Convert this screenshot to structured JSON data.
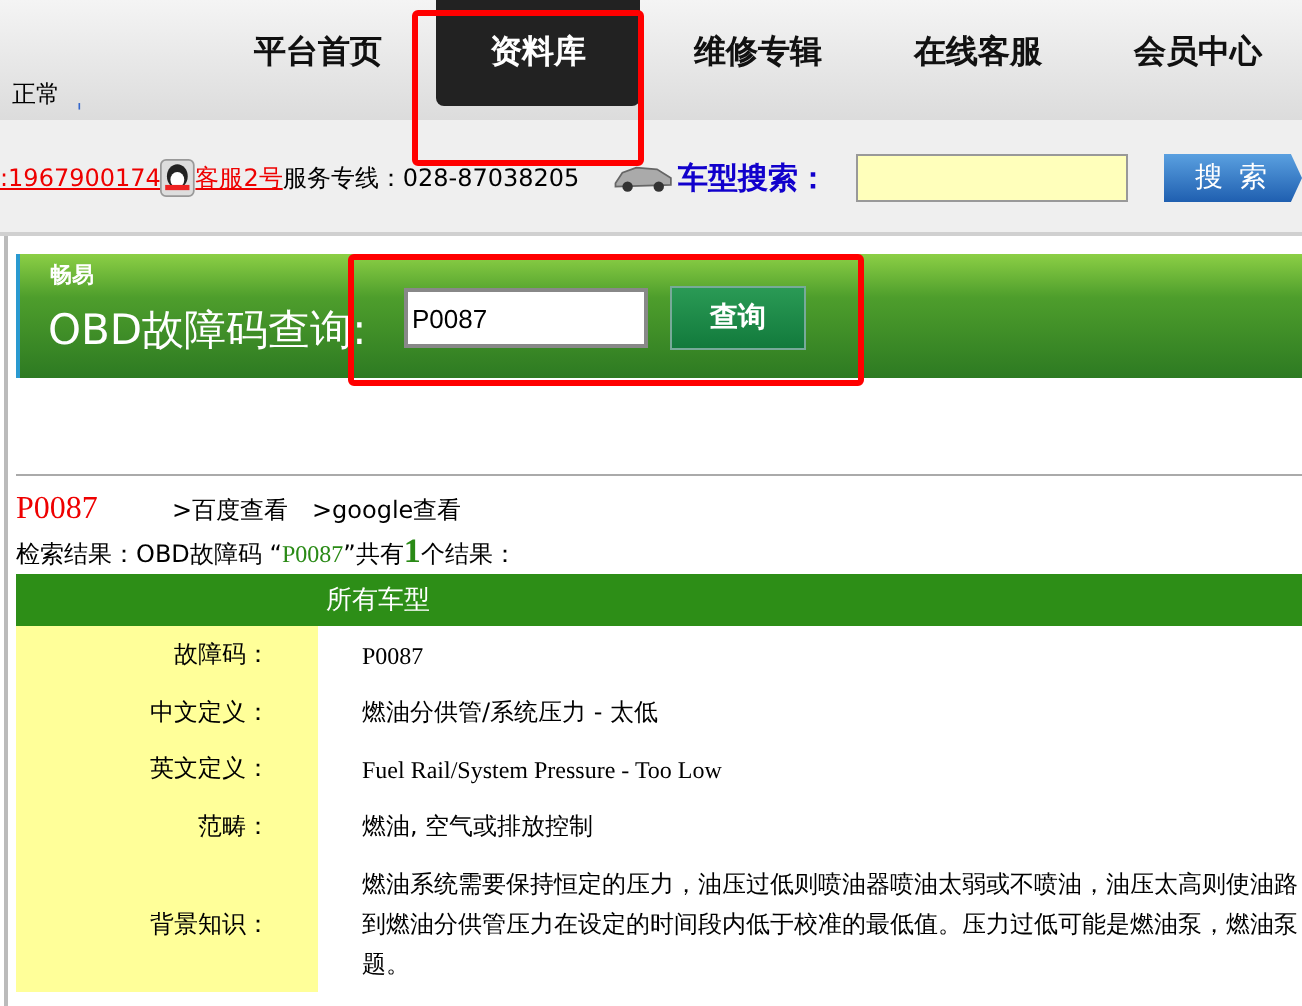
{
  "status": {
    "text": "正常",
    "mark": "ˌ"
  },
  "nav": [
    {
      "label": "平台首页",
      "selected": false,
      "highlighted": false
    },
    {
      "label": "资料库",
      "selected": true,
      "highlighted": true
    },
    {
      "label": "维修专辑",
      "selected": false,
      "highlighted": false
    },
    {
      "label": "在线客服",
      "selected": false,
      "highlighted": false
    },
    {
      "label": "会员中心",
      "selected": false,
      "highlighted": false
    }
  ],
  "contact": {
    "qq": ":1967900174",
    "service_link": "客服2号",
    "hotline": "服务专线：028-87038205"
  },
  "car_search": {
    "label": "车型搜索：",
    "button": "搜 索"
  },
  "obd": {
    "brand": "畅易",
    "title": "OBD故障码查询:",
    "value": "P0087",
    "button": "查询",
    "highlighted": true
  },
  "result": {
    "code": "P0087",
    "links": [
      ">百度查看",
      ">google查看"
    ],
    "summary_prefix": "检索结果：OBD故障码 “",
    "summary_code": "P0087",
    "summary_mid": "”共有",
    "summary_count": "1",
    "summary_suffix": "个结果："
  },
  "table": {
    "header": "所有车型",
    "rows": [
      {
        "label": "故障码：",
        "lines": [
          "P0087"
        ],
        "kind": "serif"
      },
      {
        "label": "中文定义：",
        "lines": [
          "燃油分供管/系统压力  - 太低"
        ],
        "kind": "plain"
      },
      {
        "label": "英文定义：",
        "lines": [
          "Fuel Rail/System Pressure - Too Low"
        ],
        "kind": "serif"
      },
      {
        "label": "范畴：",
        "lines": [
          "燃油, 空气或排放控制"
        ],
        "kind": "plain"
      },
      {
        "label": "背景知识：",
        "lines": [
          "燃油系统需要保持恒定的压力，油压过低则喷油器喷油太弱或不喷油，油压太高则使油路",
          "到燃油分供管压力在设定的时间段内低于校准的最低值。压力过低可能是燃油泵，燃油泵",
          "题。"
        ],
        "kind": "plain"
      }
    ]
  }
}
